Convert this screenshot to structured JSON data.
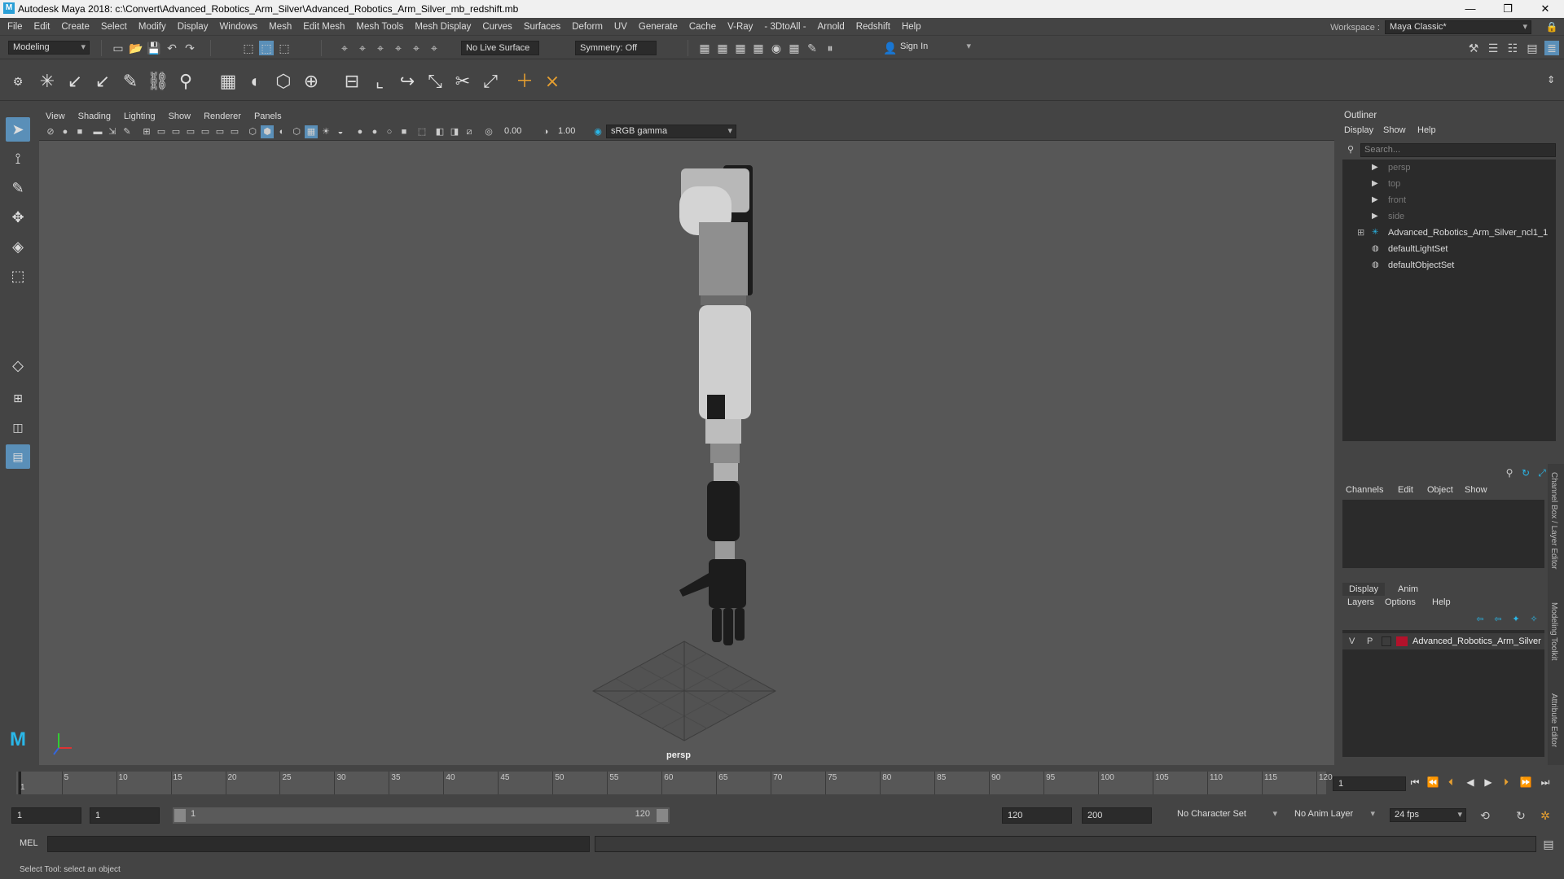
{
  "title": "Autodesk Maya 2018: c:\\Convert\\Advanced_Robotics_Arm_Silver\\Advanced_Robotics_Arm_Silver_mb_redshift.mb",
  "menus": [
    "File",
    "Edit",
    "Create",
    "Select",
    "Modify",
    "Display",
    "Windows",
    "Mesh",
    "Edit Mesh",
    "Mesh Tools",
    "Mesh Display",
    "Curves",
    "Surfaces",
    "Deform",
    "UV",
    "Generate",
    "Cache",
    "V-Ray",
    "- 3DtoAll -",
    "Arnold",
    "Redshift",
    "Help"
  ],
  "workspace": {
    "label": "Workspace :",
    "value": "Maya Classic*"
  },
  "status": {
    "mode": "Modeling",
    "live_surface": "No Live Surface",
    "symmetry": "Symmetry: Off",
    "sign_in": "Sign In"
  },
  "viewport": {
    "menus": [
      "View",
      "Shading",
      "Lighting",
      "Show",
      "Renderer",
      "Panels"
    ],
    "exposure": "0.00",
    "gamma": "1.00",
    "colorspace": "sRGB gamma",
    "camera_label": "persp"
  },
  "outliner": {
    "title": "Outliner",
    "menus": [
      "Display",
      "Show",
      "Help"
    ],
    "search_placeholder": "Search...",
    "items": [
      {
        "label": "persp",
        "dim": true
      },
      {
        "label": "top",
        "dim": true
      },
      {
        "label": "front",
        "dim": true
      },
      {
        "label": "side",
        "dim": true
      },
      {
        "label": "Advanced_Robotics_Arm_Silver_ncl1_1",
        "dim": false
      },
      {
        "label": "defaultLightSet",
        "dim": false
      },
      {
        "label": "defaultObjectSet",
        "dim": false
      }
    ]
  },
  "channelbox": {
    "menus": [
      "Channels",
      "Edit",
      "Object",
      "Show"
    ]
  },
  "layers": {
    "tabs": [
      "Display",
      "Anim"
    ],
    "menus": [
      "Layers",
      "Options",
      "Help"
    ],
    "row": {
      "v": "V",
      "p": "P",
      "name": "Advanced_Robotics_Arm_Silver",
      "color": "#b3122b"
    }
  },
  "sidetabs": [
    "Channel Box / Layer Editor",
    "Modeling Toolkit",
    "Attribute Editor"
  ],
  "timeline": {
    "ticks": [
      "1",
      "5",
      "10",
      "15",
      "20",
      "25",
      "30",
      "35",
      "40",
      "45",
      "50",
      "55",
      "60",
      "65",
      "70",
      "75",
      "80",
      "85",
      "90",
      "95",
      "100",
      "105",
      "110",
      "115",
      "120"
    ],
    "current_frame": "1"
  },
  "range": {
    "start": "1",
    "anim_start": "1",
    "slider_start": "1",
    "slider_end": "120",
    "end": "120",
    "anim_end": "200",
    "character_set": "No Character Set",
    "anim_layer": "No Anim Layer",
    "fps": "24 fps"
  },
  "cmd": {
    "label": "MEL"
  },
  "help_line": "Select Tool: select an object"
}
